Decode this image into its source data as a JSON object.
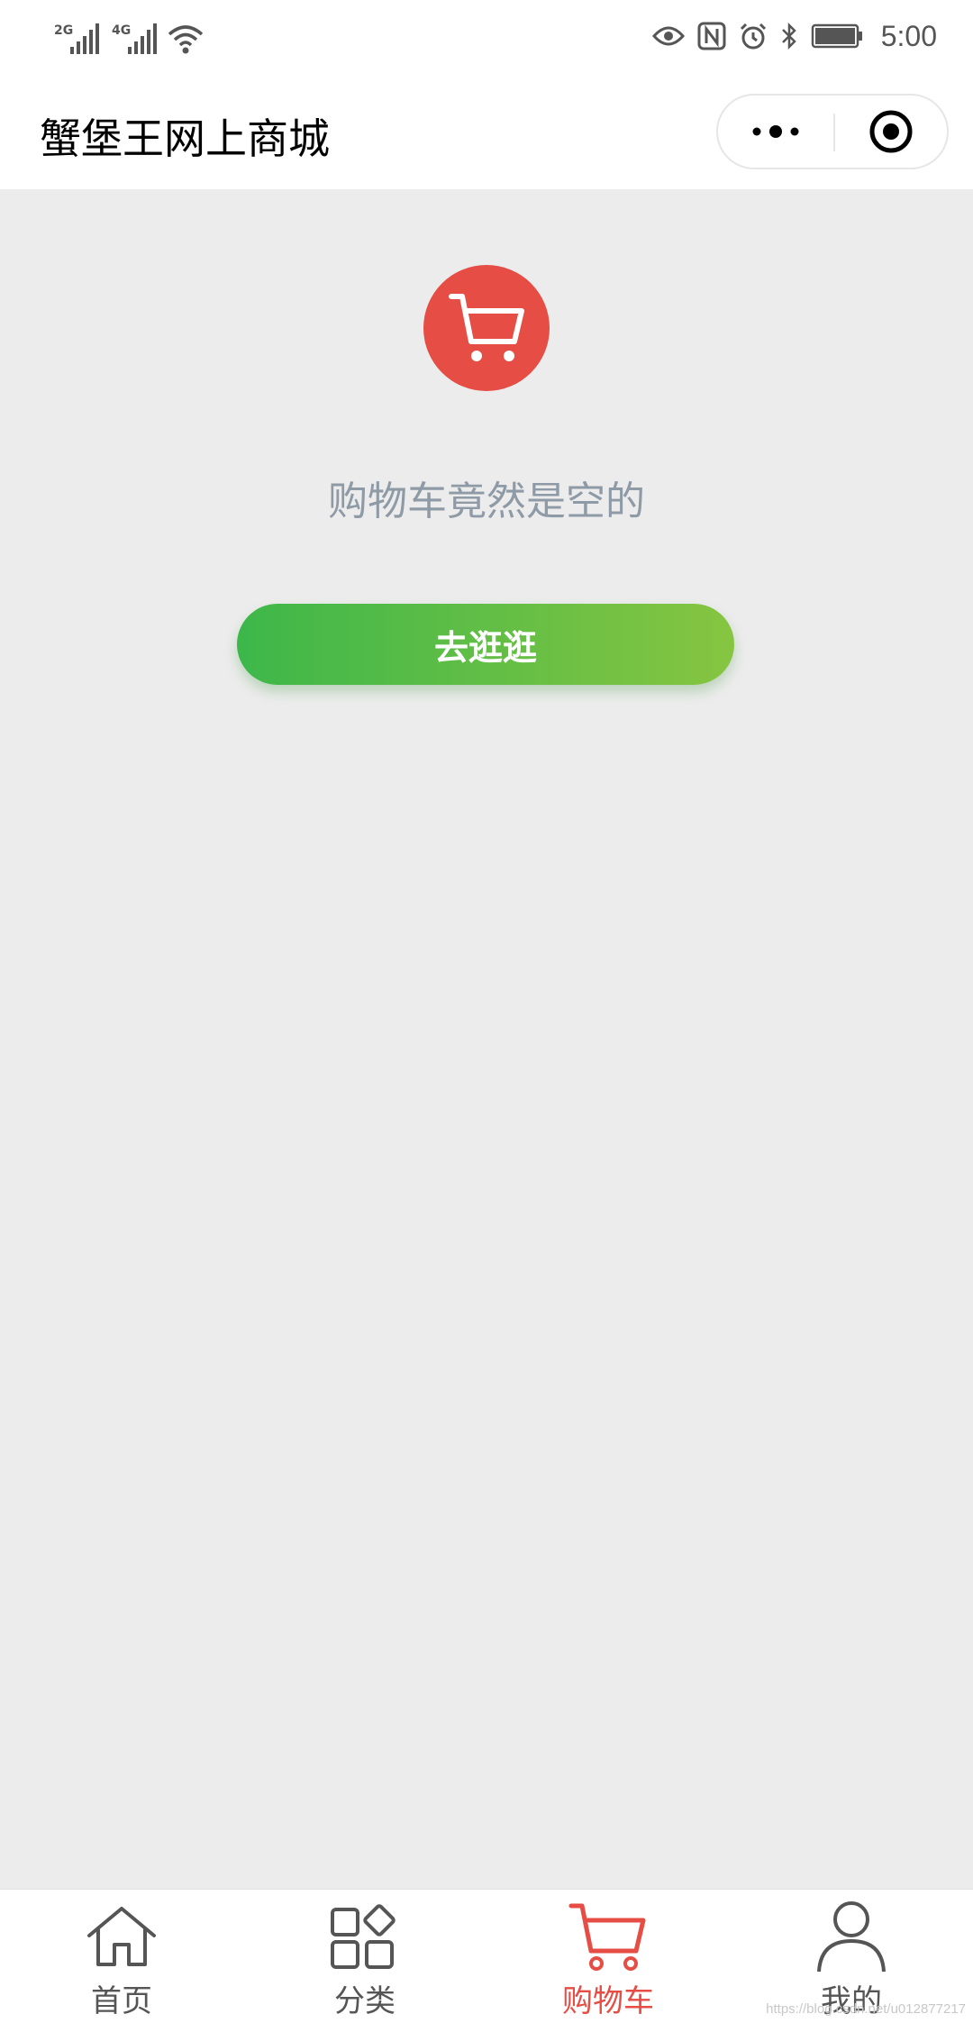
{
  "status_bar": {
    "network_1": "2G",
    "network_2": "4G",
    "time": "5:00"
  },
  "header": {
    "title": "蟹堡王网上商城"
  },
  "empty_cart": {
    "message": "购物车竟然是空的",
    "button_label": "去逛逛"
  },
  "tabs": [
    {
      "label": "首页",
      "icon": "home-icon"
    },
    {
      "label": "分类",
      "icon": "category-icon"
    },
    {
      "label": "购物车",
      "icon": "cart-icon",
      "active": true
    },
    {
      "label": "我的",
      "icon": "user-icon"
    }
  ],
  "watermark": "https://blog.csdn.net/u012877217",
  "colors": {
    "accent_red": "#e54d45",
    "button_gradient_start": "#3db74a",
    "button_gradient_end": "#86c541",
    "content_background": "#ececec",
    "muted_text": "#8e9aa6"
  }
}
